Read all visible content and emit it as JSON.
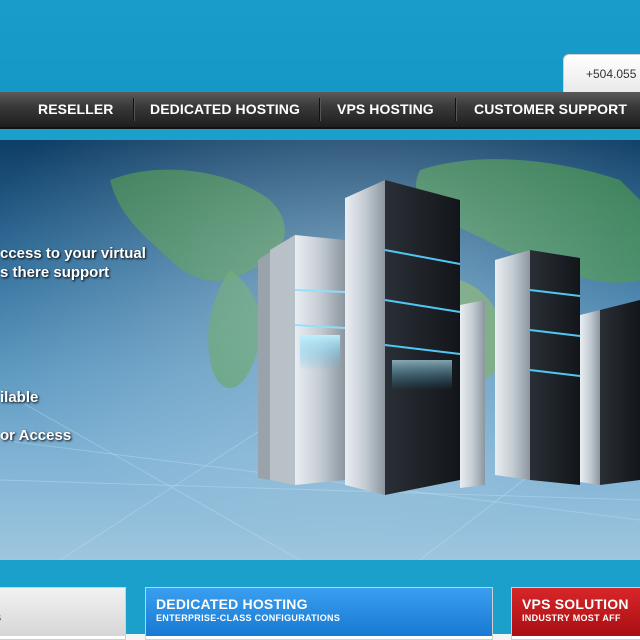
{
  "header": {
    "phone": "+504.055"
  },
  "nav": {
    "items": [
      {
        "label": "RESELLER"
      },
      {
        "label": "DEDICATED HOSTING"
      },
      {
        "label": "VPS HOSTING"
      },
      {
        "label": "CUSTOMER SUPPORT"
      }
    ]
  },
  "banner": {
    "lines": [
      "ccess to your virtual",
      "s there support",
      "ilable",
      "or Access"
    ]
  },
  "panels": [
    {
      "title": "",
      "subtitle": "S"
    },
    {
      "title": "DEDICATED HOSTING",
      "subtitle": "ENTERPRISE-CLASS CONFIGURATIONS"
    },
    {
      "title": "VPS SOLUTION",
      "subtitle": "INDUSTRY MOST AFF"
    }
  ],
  "colors": {
    "brand_blue": "#1b9cc8",
    "nav_dark": "#2a2a2a",
    "panel_blue": "#2a8fe6",
    "panel_red": "#c01a1e"
  }
}
